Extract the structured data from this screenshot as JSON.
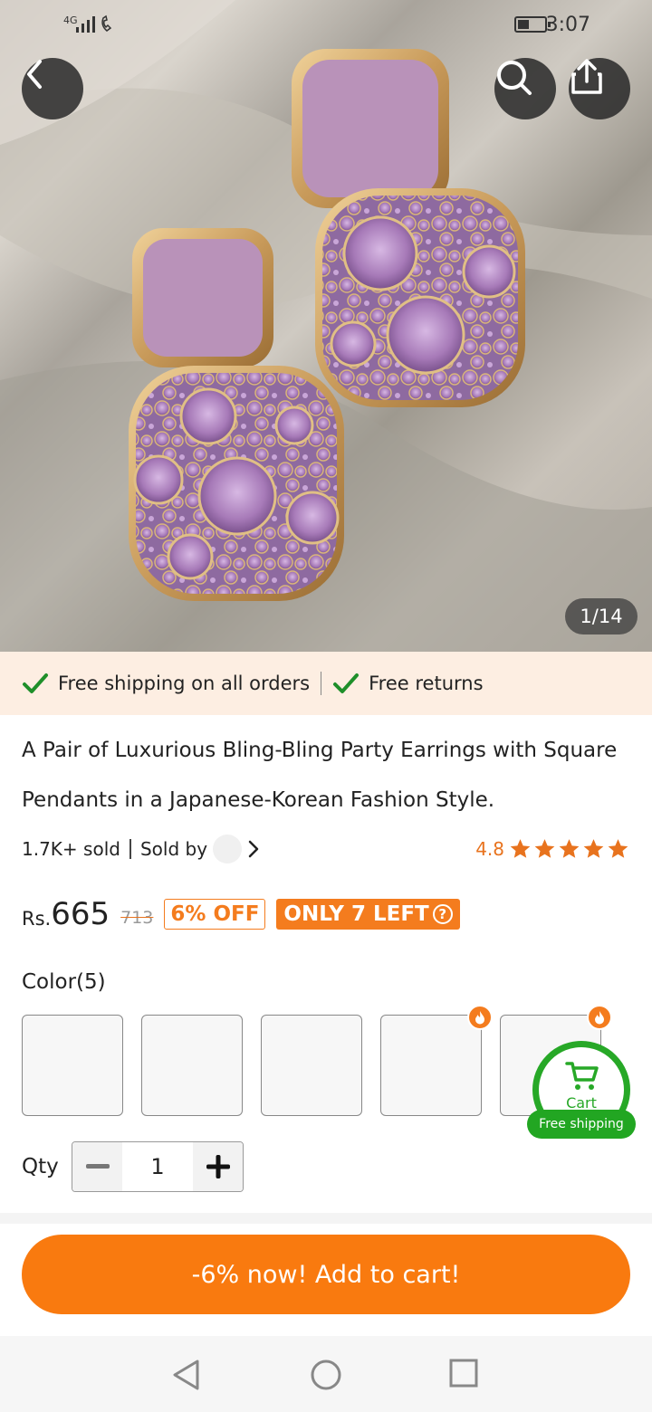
{
  "status_bar": {
    "network": "4G",
    "time": "3:07"
  },
  "gallery": {
    "counter": "1/14",
    "current_index": 1,
    "total_images": 14
  },
  "icons": {
    "back": "chevron-left-icon",
    "search": "search-icon",
    "share": "share-icon",
    "check": "check-icon",
    "star": "star-icon",
    "cart": "cart-icon",
    "hot": "flame-icon"
  },
  "shipping": {
    "item1": "Free shipping on all orders",
    "item2": "Free returns"
  },
  "product": {
    "title": "A Pair of Luxurious Bling-Bling Party Earrings with Square Pendants in a Japanese-Korean Fashion Style.",
    "sold": "1.7K+ sold",
    "sold_by": "Sold by",
    "rating": "4.8",
    "stars": 5
  },
  "price": {
    "currency": "Rs.",
    "current": "665",
    "original": "713",
    "discount": "6% OFF",
    "stock": "ONLY 7 LEFT",
    "help": "?"
  },
  "options": {
    "color_label": "Color(5)",
    "swatch_count": 5,
    "qty_label": "Qty",
    "qty_value": "1",
    "minus": "−",
    "plus": "+"
  },
  "cart": {
    "label": "Cart",
    "free_shipping": "Free shipping"
  },
  "cta": {
    "add_to_cart": "-6% now! Add to cart!"
  },
  "colors": {
    "accent": "#F97A0F",
    "rating": "#E8731E",
    "green": "#27A827",
    "strip_bg": "#FDEEE2"
  }
}
